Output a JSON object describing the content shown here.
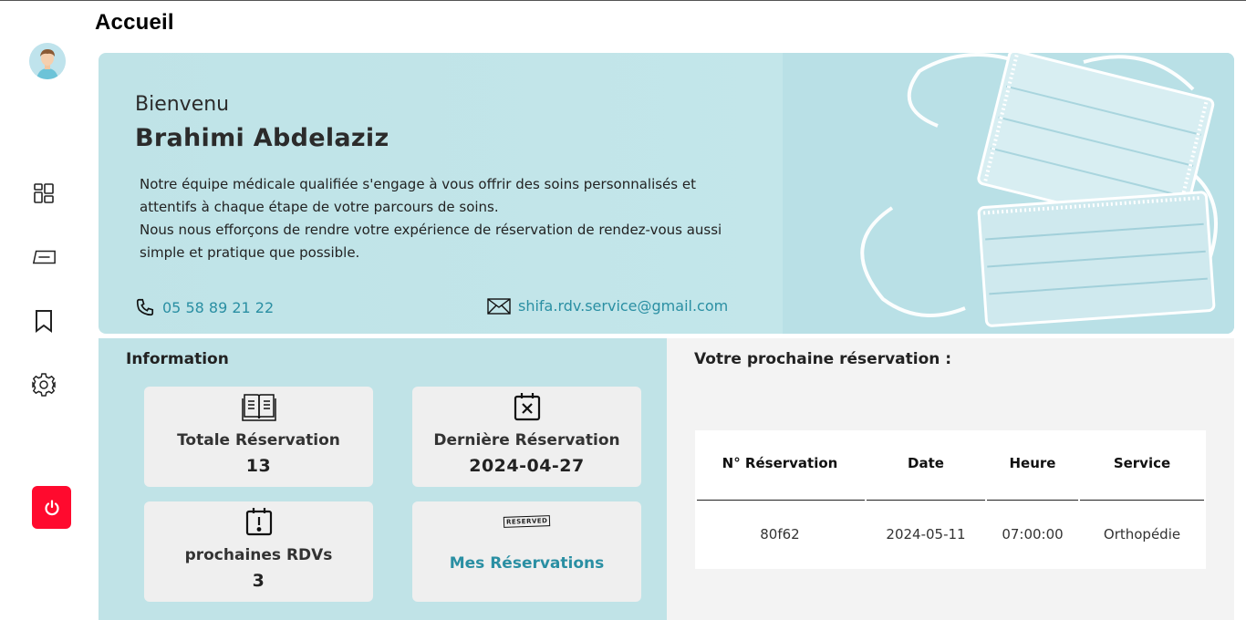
{
  "page": {
    "title": "Accueil"
  },
  "sidebar": {
    "items": [
      {
        "name": "dashboard-icon"
      },
      {
        "name": "ticket-icon"
      },
      {
        "name": "bookmark-icon"
      },
      {
        "name": "gear-icon"
      }
    ],
    "logout": {
      "name": "power-icon",
      "color": "#ff0a2e"
    }
  },
  "hero": {
    "greeting": "Bienvenu",
    "user_name": "Brahimi Abdelaziz",
    "text_line1": "Notre équipe médicale qualifiée s'engage à vous offrir des soins personnalisés et",
    "text_line2": "attentifs à chaque étape de votre parcours de soins.",
    "text_line3": "Nous nous efforçons de rendre votre expérience de réservation de rendez-vous aussi",
    "text_line4": "simple et pratique que possible.",
    "phone": "05 58 89 21 22",
    "email": "shifa.rdv.service@gmail.com"
  },
  "info": {
    "title": "Information",
    "cards": [
      {
        "icon": "book-icon",
        "label": "Totale Réservation",
        "value": "13"
      },
      {
        "icon": "calendar-x-icon",
        "label": "Dernière Réservation",
        "value": "2024-04-27"
      },
      {
        "icon": "calendar-alert-icon",
        "label": "prochaines RDVs",
        "value": "3"
      },
      {
        "icon": "reserved-stamp-icon",
        "link": "Mes Réservations",
        "stamp": "RESERVED"
      }
    ]
  },
  "next_reservation": {
    "title": "Votre prochaine réservation :",
    "columns": [
      "N° Réservation",
      "Date",
      "Heure",
      "Service"
    ],
    "row": [
      "80f62",
      "2024-05-11",
      "07:00:00",
      "Orthopédie"
    ]
  },
  "colors": {
    "accent": "#2a8fa3",
    "info_bg": "#c0e3e7",
    "danger": "#ff0a2e"
  }
}
